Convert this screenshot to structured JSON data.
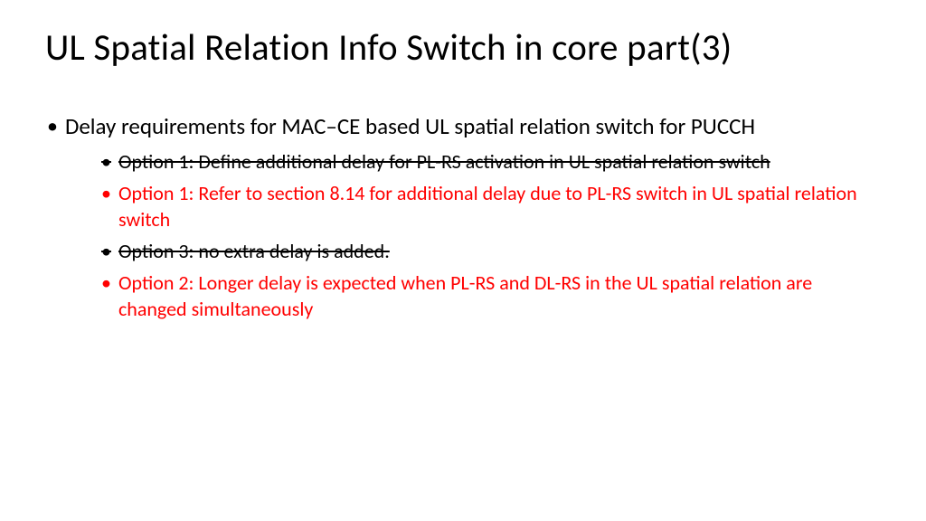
{
  "title": "UL Spatial Relation Info Switch in core part(3)",
  "mainBullet": "Delay requirements for MAC–CE based UL spatial relation switch for PUCCH",
  "subBullets": [
    {
      "text": "Option 1:  Define additional delay for PL-RS activation in UL spatial relation switch",
      "color": "black",
      "strike": true
    },
    {
      "text": "Option 1: Refer to section 8.14 for additional delay due to PL-RS switch in UL spatial relation switch",
      "color": "red",
      "strike": false
    },
    {
      "text": "Option 3: no extra delay is added.",
      "color": "black",
      "strike": true
    },
    {
      "text": "Option 2: Longer delay is expected when PL-RS and DL-RS in the UL spatial relation are changed simultaneously",
      "color": "red",
      "strike": false
    }
  ]
}
